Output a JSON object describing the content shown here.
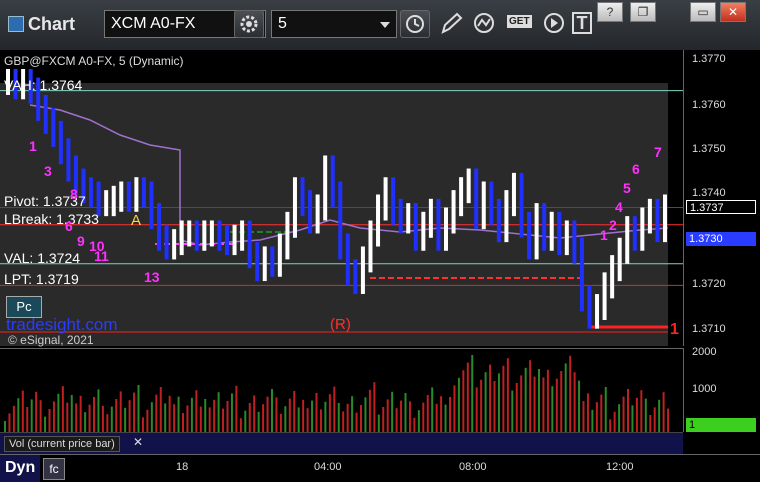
{
  "window": {
    "title": "Chart",
    "help_label": "?",
    "restore_label": "❐",
    "min_label": "▭",
    "close_label": "✕"
  },
  "toolbar": {
    "symbol": "XCM A0-FX",
    "interval": "5",
    "get_label": "GET",
    "text_tool_label": "T"
  },
  "chart": {
    "header_line": "GBP@FXCM A0-FX, 5 (Dynamic)",
    "marker_a": "A",
    "marker_r": "(R)",
    "watermark": "tradesight.com",
    "copyright": "© eSignal, 2021",
    "pc_button": "Pc",
    "levels": [
      {
        "label": "VAH: 1.3764",
        "value": 1.3764,
        "color": "#7fd6c4"
      },
      {
        "label": "Pivot: 1.3737",
        "value": 1.3737,
        "color": "#2a3cff"
      },
      {
        "label": "LBreak: 1.3733",
        "value": 1.3733,
        "color": "#ff3030"
      },
      {
        "label": "VAL: 1.3724",
        "value": 1.3724,
        "color": "#7fd6c4"
      },
      {
        "label": "LPT: 1.3719",
        "value": 1.3719,
        "color": "#cc3030"
      }
    ],
    "count_labels": [
      {
        "text": "1",
        "color": "#ff30ff"
      },
      {
        "text": "3",
        "color": "#ff30ff"
      },
      {
        "text": "6",
        "color": "#ff30ff"
      },
      {
        "text": "8",
        "color": "#ff30ff"
      },
      {
        "text": "9",
        "color": "#ff30ff"
      },
      {
        "text": "10",
        "color": "#ff30ff"
      },
      {
        "text": "11",
        "color": "#ff30ff"
      },
      {
        "text": "13",
        "color": "#ff30ff"
      },
      {
        "text": "1",
        "color": "#ff30ff"
      },
      {
        "text": "2",
        "color": "#ff30ff"
      },
      {
        "text": "4",
        "color": "#ff30ff"
      },
      {
        "text": "5",
        "color": "#ff30ff"
      },
      {
        "text": "6",
        "color": "#ff30ff"
      },
      {
        "text": "7",
        "color": "#ff30ff"
      },
      {
        "text": "1",
        "color": "#ff2020"
      }
    ]
  },
  "price_axis": {
    "ticks": [
      "1.3770",
      "1.3760",
      "1.3750",
      "1.3740",
      "1.3720",
      "1.3710"
    ],
    "last_price": "1.3737",
    "poc_price": "1.3730"
  },
  "volume": {
    "label": "Vol (current price bar)",
    "ticks": [
      "2000",
      "1000"
    ],
    "current": "1"
  },
  "time_axis": {
    "ticks": [
      "18",
      "04:00",
      "08:00",
      "12:00"
    ]
  },
  "status": {
    "dyn_label": "Dyn"
  },
  "colors": {
    "up_bar": "#ffffff",
    "down_bar": "#2030ff",
    "vwap": "#a070d0",
    "volume_up": "#2a8a2a",
    "volume_down": "#c02020"
  }
}
